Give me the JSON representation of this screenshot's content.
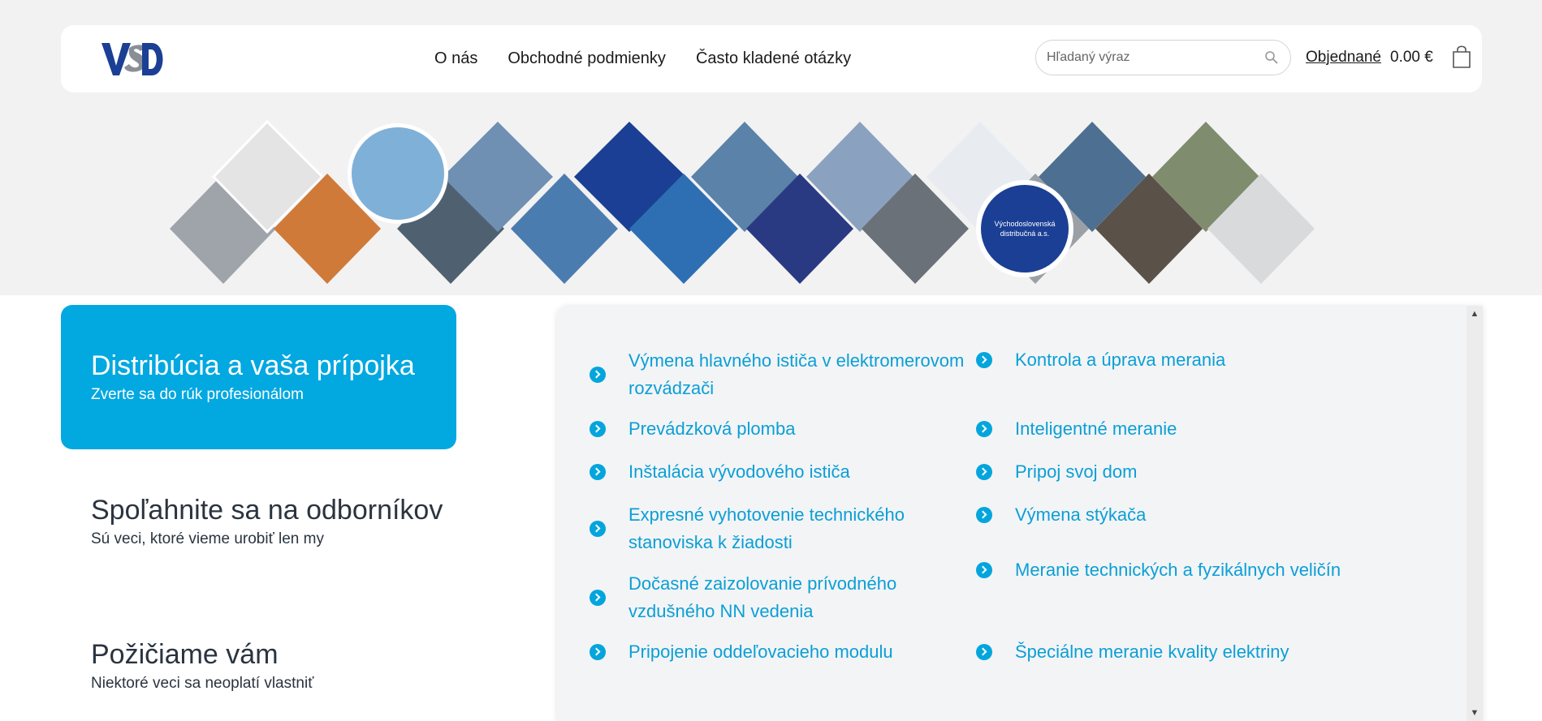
{
  "header": {
    "logo_text": "VSD",
    "nav": [
      "O nás",
      "Obchodné podmienky",
      "Často kladené otázky"
    ],
    "search_placeholder": "Hľadaný výraz",
    "orders_label": "Objednané",
    "cart_amount": "0.00 €"
  },
  "banner": {
    "badge_text_line1": "Východoslovenská",
    "badge_text_line2": "distribučná a.s."
  },
  "left_menu": [
    {
      "title": "Distribúcia a vaša prípojka",
      "subtitle": "Zverte sa do rúk profesionálom"
    },
    {
      "title": "Spoľahnite sa na odborníkov",
      "subtitle": "Sú veci, ktoré vieme urobiť len my"
    },
    {
      "title": "Požičiame vám",
      "subtitle": "Niektoré veci sa neoplatí vlastniť"
    }
  ],
  "services_left": [
    "Výmena hlavného ističa v elektromerovom rozvádzači",
    "Prevádzková plomba",
    "Inštalácia vývodového ističa",
    "Expresné vyhotovenie technického stanoviska k žiadosti",
    "Dočasné zaizolovanie prívodného vzdušného NN vedenia",
    "Pripojenie oddeľovacieho modulu"
  ],
  "services_right": [
    "Kontrola a úprava merania",
    "Inteligentné meranie",
    "Pripoj svoj dom",
    "Výmena stýkača",
    "Meranie technických a fyzikálnych veličín",
    "Špeciálne meranie kvality elektriny"
  ],
  "colors": {
    "accent": "#02a8e0",
    "link": "#0a9fd6",
    "brand_blue": "#1b3f94"
  }
}
